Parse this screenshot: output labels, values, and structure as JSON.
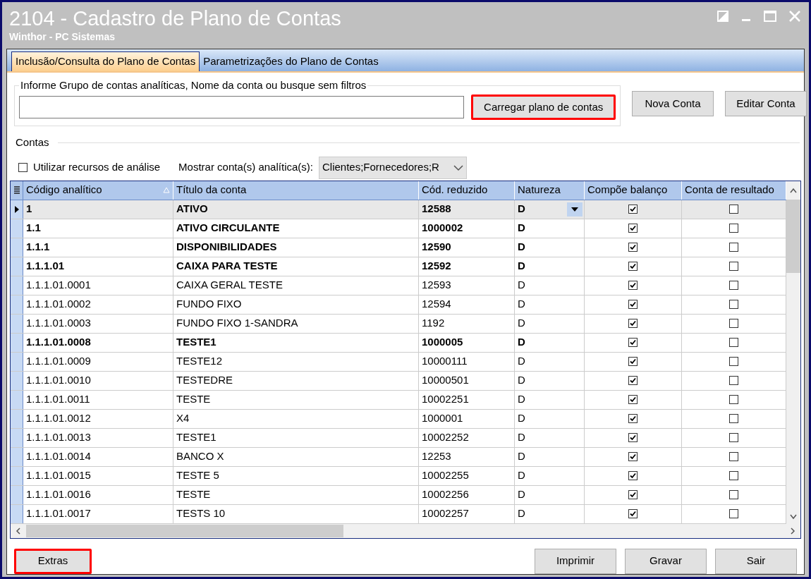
{
  "window": {
    "title": "2104 - Cadastro de Plano de Contas",
    "subtitle": "Winthor - PC Sistemas"
  },
  "tabs": [
    {
      "label": "Inclusão/Consulta do Plano de Contas",
      "selected": true
    },
    {
      "label": "Parametrizações do Plano de Contas",
      "selected": false
    }
  ],
  "search": {
    "label": "Informe Grupo de contas analíticas, Nome da conta ou busque sem filtros"
  },
  "top_buttons": [
    {
      "label": "Carregar plano de contas",
      "highlighted": true
    },
    {
      "label": "Nova Conta",
      "highlighted": false
    },
    {
      "label": "Editar Conta",
      "highlighted": false
    }
  ],
  "contas": {
    "label": "Contas",
    "analysis_checkbox": {
      "label": "Utilizar recursos de análise",
      "checked": false
    },
    "filter_label": "Mostrar conta(s) analítica(s):",
    "filter_value": "Clientes;Fornecedores;R"
  },
  "table": {
    "columns": [
      "Código analítico",
      "Título da conta",
      "Cód. reduzido",
      "Natureza",
      "Compõe balanço",
      "Conta de resultado"
    ],
    "rows": [
      {
        "code": "1",
        "title": "ATIVO",
        "reduced": "12588",
        "nature": "D",
        "balance": true,
        "result": false,
        "bold": true,
        "selected": true
      },
      {
        "code": "1.1",
        "title": "ATIVO CIRCULANTE",
        "reduced": "1000002",
        "nature": "D",
        "balance": true,
        "result": false,
        "bold": true,
        "selected": false
      },
      {
        "code": "1.1.1",
        "title": "DISPONIBILIDADES",
        "reduced": "12590",
        "nature": "D",
        "balance": true,
        "result": false,
        "bold": true,
        "selected": false
      },
      {
        "code": "1.1.1.01",
        "title": "CAIXA PARA TESTE",
        "reduced": "12592",
        "nature": "D",
        "balance": true,
        "result": false,
        "bold": true,
        "selected": false
      },
      {
        "code": "1.1.1.01.0001",
        "title": "CAIXA GERAL TESTE",
        "reduced": "12593",
        "nature": "D",
        "balance": true,
        "result": false,
        "bold": false,
        "selected": false
      },
      {
        "code": "1.1.1.01.0002",
        "title": "FUNDO FIXO",
        "reduced": "12594",
        "nature": "D",
        "balance": true,
        "result": false,
        "bold": false,
        "selected": false
      },
      {
        "code": "1.1.1.01.0003",
        "title": "FUNDO FIXO 1-SANDRA",
        "reduced": "1192",
        "nature": "D",
        "balance": true,
        "result": false,
        "bold": false,
        "selected": false
      },
      {
        "code": "1.1.1.01.0008",
        "title": "TESTE1",
        "reduced": "1000005",
        "nature": "D",
        "balance": true,
        "result": false,
        "bold": true,
        "selected": false
      },
      {
        "code": "1.1.1.01.0009",
        "title": "TESTE12",
        "reduced": "10000111",
        "nature": "D",
        "balance": true,
        "result": false,
        "bold": false,
        "selected": false
      },
      {
        "code": "1.1.1.01.0010",
        "title": "TESTEDRE",
        "reduced": "10000501",
        "nature": "D",
        "balance": true,
        "result": false,
        "bold": false,
        "selected": false
      },
      {
        "code": "1.1.1.01.0011",
        "title": "TESTE",
        "reduced": "10002251",
        "nature": "D",
        "balance": true,
        "result": false,
        "bold": false,
        "selected": false
      },
      {
        "code": "1.1.1.01.0012",
        "title": "X4",
        "reduced": "1000001",
        "nature": "D",
        "balance": true,
        "result": false,
        "bold": false,
        "selected": false
      },
      {
        "code": "1.1.1.01.0013",
        "title": "TESTE1",
        "reduced": "10002252",
        "nature": "D",
        "balance": true,
        "result": false,
        "bold": false,
        "selected": false
      },
      {
        "code": "1.1.1.01.0014",
        "title": "BANCO X",
        "reduced": "12253",
        "nature": "D",
        "balance": true,
        "result": false,
        "bold": false,
        "selected": false
      },
      {
        "code": "1.1.1.01.0015",
        "title": "TESTE 5",
        "reduced": "10002255",
        "nature": "D",
        "balance": true,
        "result": false,
        "bold": false,
        "selected": false
      },
      {
        "code": "1.1.1.01.0016",
        "title": "TESTE",
        "reduced": "10002256",
        "nature": "D",
        "balance": true,
        "result": false,
        "bold": false,
        "selected": false
      },
      {
        "code": "1.1.1.01.0017",
        "title": "TESTS 10",
        "reduced": "10002257",
        "nature": "D",
        "balance": true,
        "result": false,
        "bold": false,
        "selected": false
      }
    ]
  },
  "left_buttons": [
    {
      "label": "Extras",
      "highlighted": true
    }
  ],
  "bottom_buttons": [
    {
      "label": "Imprimir",
      "highlighted": false
    },
    {
      "label": "Gravar",
      "highlighted": false
    },
    {
      "label": "Sair",
      "highlighted": false
    }
  ]
}
